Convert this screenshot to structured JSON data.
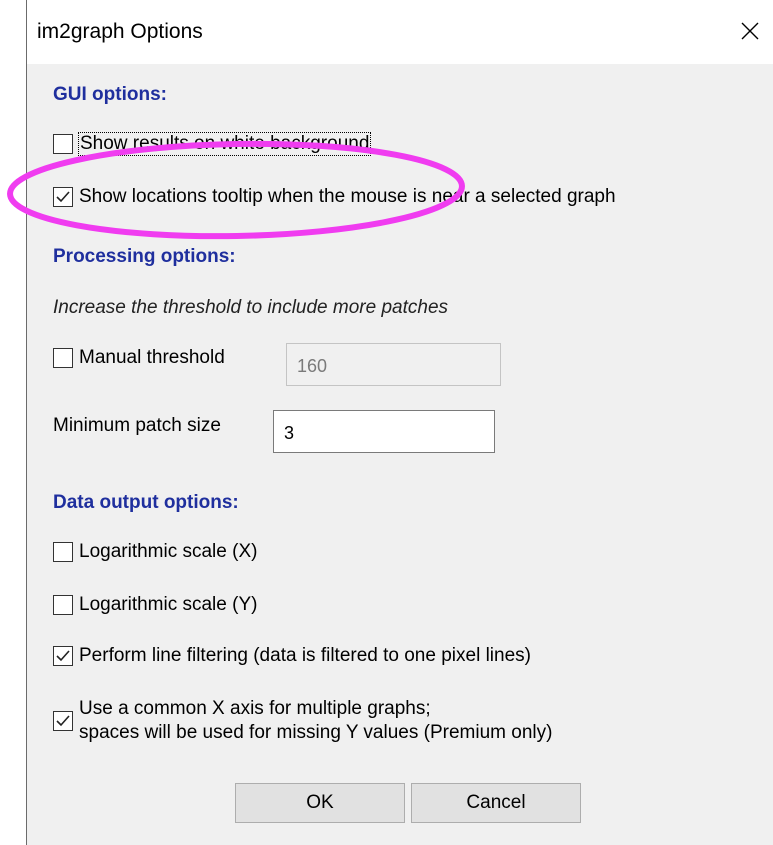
{
  "window": {
    "title": "im2graph Options",
    "close_icon": "close-icon"
  },
  "gui_options": {
    "header": "GUI options:",
    "show_white_background": {
      "label": "Show results on white background",
      "checked": false
    },
    "show_tooltip": {
      "label": "Show locations tooltip when the mouse is near a selected graph",
      "checked": true
    }
  },
  "processing_options": {
    "header": "Processing options:",
    "note": "Increase the threshold to include more patches",
    "manual_threshold": {
      "label": "Manual threshold",
      "checked": false,
      "value": "160"
    },
    "min_patch_size": {
      "label": "Minimum patch size",
      "value": "3"
    }
  },
  "data_output_options": {
    "header": "Data output options:",
    "log_x": {
      "label": "Logarithmic scale (X)",
      "checked": false
    },
    "log_y": {
      "label": "Logarithmic scale (Y)",
      "checked": false
    },
    "line_filtering": {
      "label": "Perform line filtering (data is filtered to one pixel lines)",
      "checked": true
    },
    "common_x_axis": {
      "label_line1": "Use a common X axis for multiple graphs;",
      "label_line2": "spaces will be used for missing Y values (Premium only)",
      "checked": true
    }
  },
  "buttons": {
    "ok": "OK",
    "cancel": "Cancel"
  },
  "annotation": {
    "color": "#f03cf0"
  }
}
